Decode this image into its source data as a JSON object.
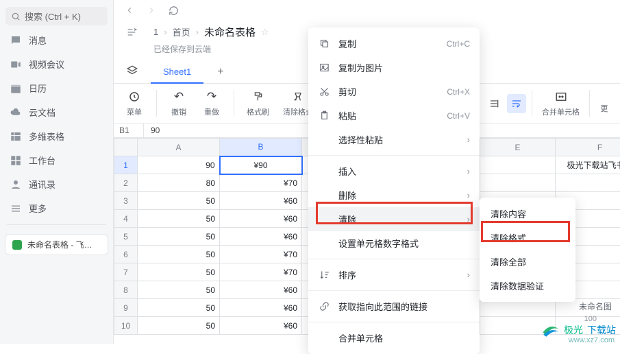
{
  "search": {
    "placeholder": "搜索 (Ctrl + K)"
  },
  "sidebar": {
    "items": [
      "消息",
      "视频会议",
      "日历",
      "云文档",
      "多维表格",
      "工作台",
      "通讯录",
      "更多"
    ],
    "sheetChip": "未命名表格 - 飞…"
  },
  "breadcrumb": {
    "root": "1",
    "home": "首页",
    "title": "未命名表格"
  },
  "saved": "已经保存到云端",
  "tabs": {
    "sheet": "Sheet1"
  },
  "toolbar": {
    "menu": "菜单",
    "undo": "撤销",
    "redo": "重做",
    "format": "格式刷",
    "clear": "清除格式",
    "merge": "合并单元格",
    "more": "更"
  },
  "cellref": {
    "ref": "B1",
    "val": "90"
  },
  "cols": {
    "A": "A",
    "B": "B",
    "E": "E",
    "F": "F"
  },
  "rows": [
    {
      "n": "1",
      "a": "90",
      "b": "¥90",
      "f": "极光下载站飞书表"
    },
    {
      "n": "2",
      "a": "80",
      "b": "¥70"
    },
    {
      "n": "3",
      "a": "50",
      "b": "¥60"
    },
    {
      "n": "4",
      "a": "50",
      "b": "¥60"
    },
    {
      "n": "5",
      "a": "50",
      "b": "¥60"
    },
    {
      "n": "6",
      "a": "50",
      "b": "¥70"
    },
    {
      "n": "7",
      "a": "50",
      "b": "¥70"
    },
    {
      "n": "8",
      "a": "50",
      "b": "¥60"
    },
    {
      "n": "9",
      "a": "50",
      "b": "¥60"
    },
    {
      "n": "10",
      "a": "50",
      "b": "¥60"
    }
  ],
  "ctx": {
    "copy": "复制",
    "copySc": "Ctrl+C",
    "copyImg": "复制为图片",
    "cut": "剪切",
    "cutSc": "Ctrl+X",
    "paste": "粘贴",
    "pasteSc": "Ctrl+V",
    "pasteSpecial": "选择性粘贴",
    "insert": "插入",
    "delete": "删除",
    "clear": "清除",
    "numfmt": "设置单元格数字格式",
    "sort": "排序",
    "link": "获取指向此范围的链接",
    "merge": "合并单元格"
  },
  "sub": {
    "content": "清除内容",
    "format": "清除格式",
    "all": "清除全部",
    "valid": "清除数据验证"
  },
  "slider": "100",
  "bottomTab": "未命名图",
  "wm": {
    "a": "极光",
    "b": "下载站",
    "url": "www.xz7.com"
  }
}
